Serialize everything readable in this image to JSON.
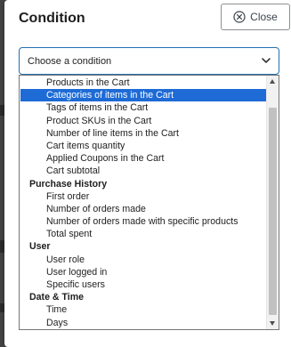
{
  "dialog": {
    "title": "Condition",
    "close_label": "Close"
  },
  "select": {
    "selected_label": "Choose a condition"
  },
  "options": [
    {
      "label": "Products in the Cart",
      "kind": "option"
    },
    {
      "label": "Categories of items in the Cart",
      "kind": "option",
      "highlighted": true
    },
    {
      "label": "Tags of items in the Cart",
      "kind": "option"
    },
    {
      "label": "Product SKUs in the Cart",
      "kind": "option"
    },
    {
      "label": "Number of line items in the Cart",
      "kind": "option"
    },
    {
      "label": "Cart items quantity",
      "kind": "option"
    },
    {
      "label": "Applied Coupons in the Cart",
      "kind": "option"
    },
    {
      "label": "Cart subtotal",
      "kind": "option"
    },
    {
      "label": "Purchase History",
      "kind": "group"
    },
    {
      "label": "First order",
      "kind": "option"
    },
    {
      "label": "Number of orders made",
      "kind": "option"
    },
    {
      "label": "Number of orders made with specific products",
      "kind": "option"
    },
    {
      "label": "Total spent",
      "kind": "option"
    },
    {
      "label": "User",
      "kind": "group"
    },
    {
      "label": "User role",
      "kind": "option"
    },
    {
      "label": "User logged in",
      "kind": "option"
    },
    {
      "label": "Specific users",
      "kind": "option"
    },
    {
      "label": "Date & Time",
      "kind": "group"
    },
    {
      "label": "Time",
      "kind": "option"
    },
    {
      "label": "Days",
      "kind": "option"
    }
  ],
  "colors": {
    "highlight": "#1e6bd6",
    "select_border": "#2271b1"
  },
  "icons": {
    "close": "circle-x-icon",
    "select_arrow": "chevron-down-icon"
  }
}
